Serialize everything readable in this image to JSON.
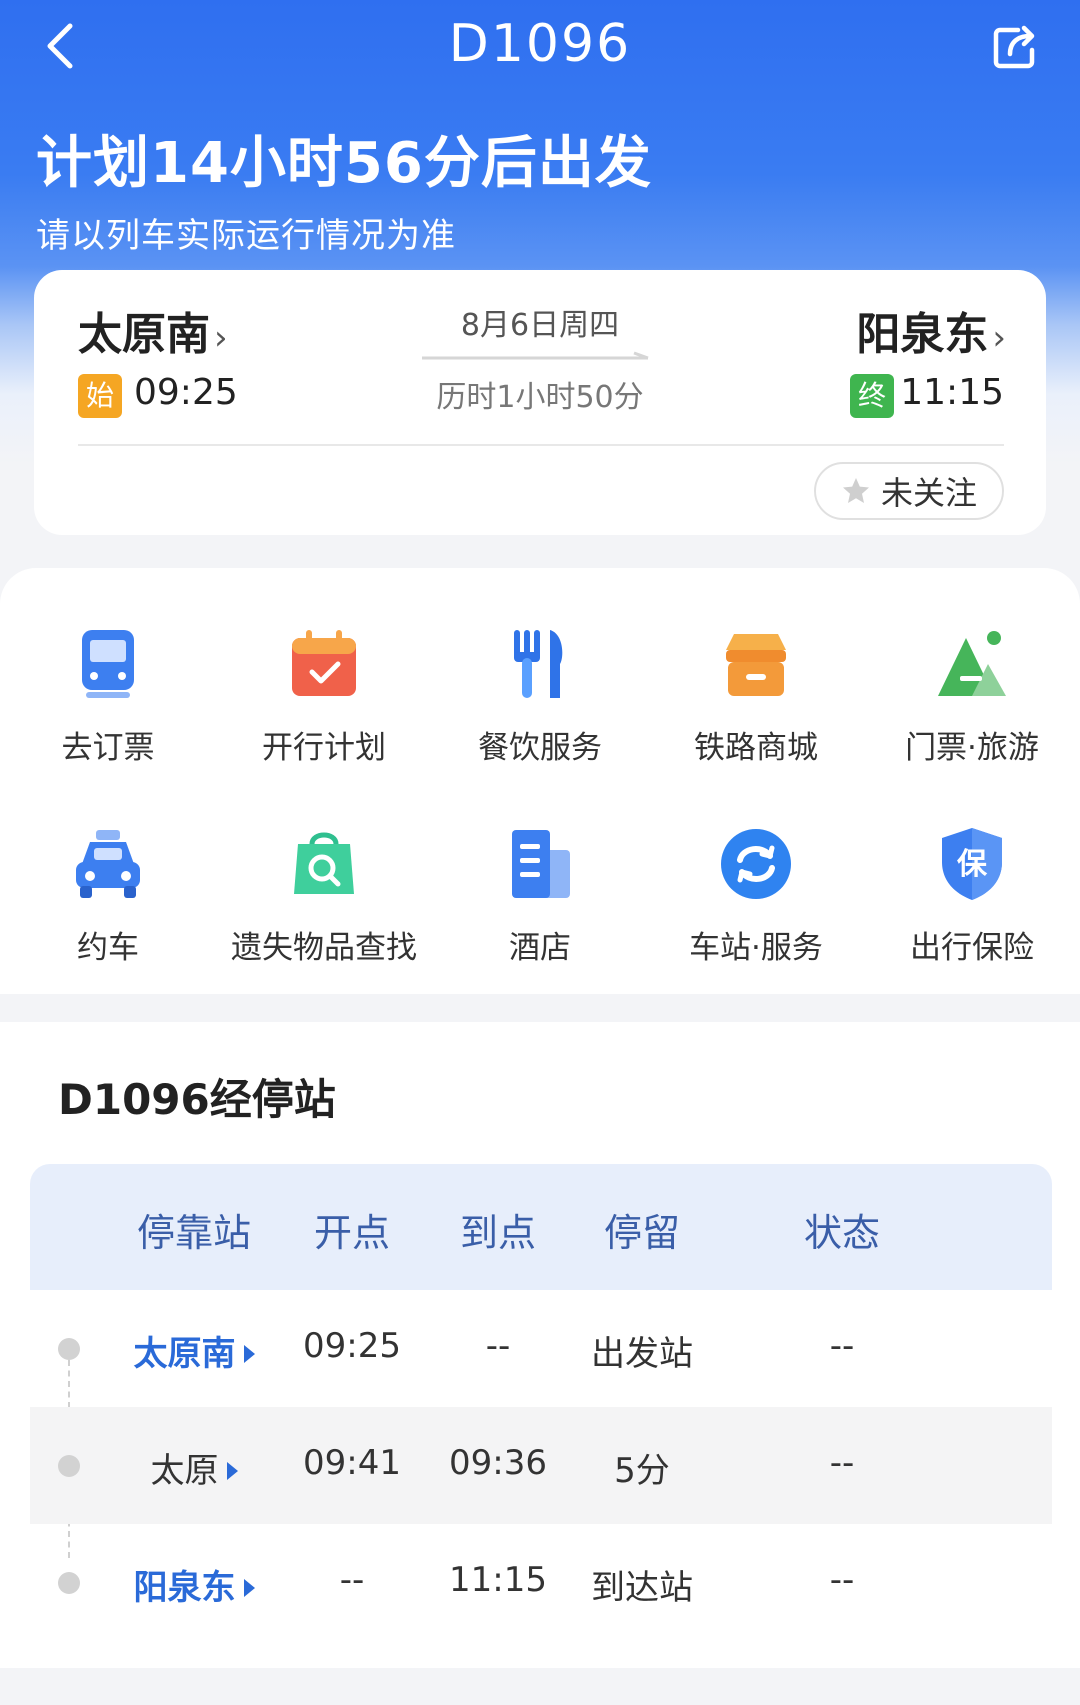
{
  "header": {
    "train_no": "D1096",
    "headline": "计划14小时56分后出发",
    "subline": "请以列车实际运行情况为准"
  },
  "journey": {
    "from_station": "太原南",
    "from_badge": "始",
    "depart_time": "09:25",
    "date": "8月6日周四",
    "duration": "历时1小时50分",
    "to_station": "阳泉东",
    "to_badge": "终",
    "arrive_time": "11:15",
    "follow_label": "未关注"
  },
  "services": [
    {
      "label": "去订票",
      "icon": "train-icon"
    },
    {
      "label": "开行计划",
      "icon": "calendar-icon"
    },
    {
      "label": "餐饮服务",
      "icon": "fork-knife-icon"
    },
    {
      "label": "铁路商城",
      "icon": "shop-icon"
    },
    {
      "label": "门票·旅游",
      "icon": "mountain-icon"
    },
    {
      "label": "约车",
      "icon": "car-icon"
    },
    {
      "label": "遗失物品查找",
      "icon": "lost-bag-icon"
    },
    {
      "label": "酒店",
      "icon": "hotel-icon"
    },
    {
      "label": "车站·服务",
      "icon": "refresh-icon"
    },
    {
      "label": "出行保险",
      "icon": "insurance-shield-icon"
    }
  ],
  "stops": {
    "title": "D1096经停站",
    "columns": [
      "停靠站",
      "开点",
      "到点",
      "停留",
      "状态"
    ],
    "rows": [
      {
        "station": "太原南",
        "depart": "09:25",
        "arrive": "--",
        "stay": "出发站",
        "status": "--"
      },
      {
        "station": "太原",
        "depart": "09:41",
        "arrive": "09:36",
        "stay": "5分",
        "status": "--"
      },
      {
        "station": "阳泉东",
        "depart": "--",
        "arrive": "11:15",
        "stay": "到达站",
        "status": "--"
      }
    ]
  },
  "colors": {
    "brand_blue": "#2f6ff0",
    "start_badge": "#f5a623",
    "end_badge": "#3fb54f",
    "station_link": "#2a6ad8"
  }
}
